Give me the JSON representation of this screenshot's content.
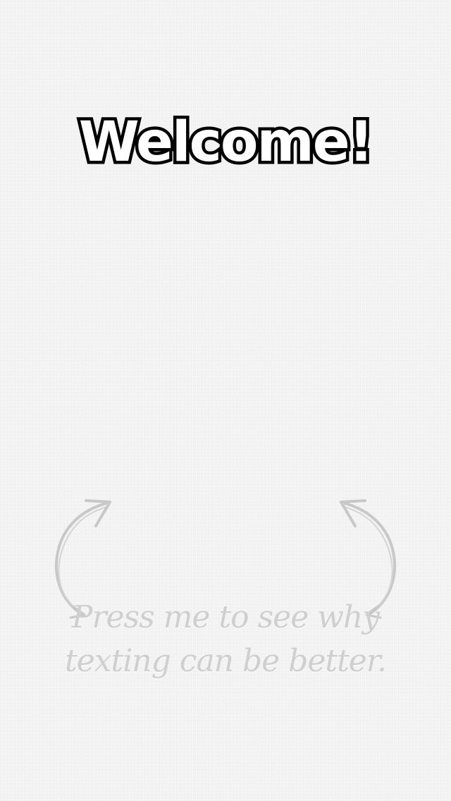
{
  "welcome": {
    "title": "Welcome!"
  },
  "hint": {
    "line1": "Press me to see why",
    "line2": "texting can be better."
  },
  "icons": {
    "left_arrow": "curved-arrow-up-right-icon",
    "right_arrow": "curved-arrow-up-left-icon"
  },
  "colors": {
    "background": "#f4f4f4",
    "title_fill": "#ffffff",
    "title_stroke": "#000000",
    "hint_text": "#cfcfcf",
    "arrow": "#c8c8c8"
  }
}
